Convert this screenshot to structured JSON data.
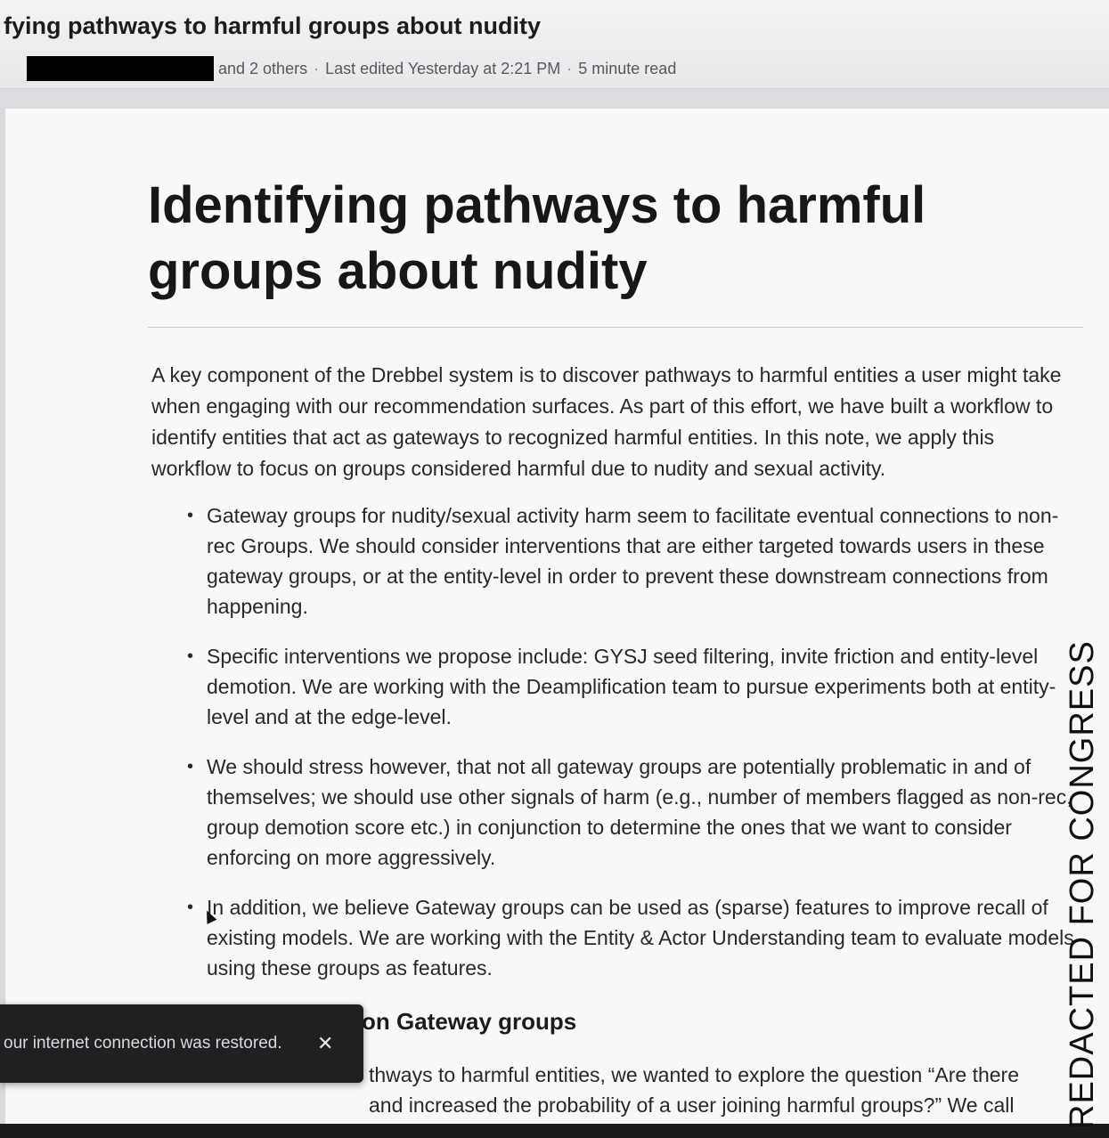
{
  "header": {
    "title": "fying pathways to harmful groups about nudity",
    "authors_suffix": "and 2 others",
    "last_edited": "Last edited Yesterday at 2:21 PM",
    "read_time": "5 minute read",
    "separator": "·"
  },
  "document": {
    "title": "Identifying pathways to harmful groups about nudity",
    "intro": "A key component of the Drebbel system is to discover pathways to harmful entities a user might take when engaging with our recommendation surfaces. As part of this effort, we have built a workflow to identify entities that act as gateways to recognized harmful entities. In this note, we apply this workflow to focus on groups considered harmful due to nudity and sexual activity.",
    "bullets": [
      "Gateway groups for nudity/sexual activity harm seem to facilitate eventual connections to non-rec Groups. We should consider interventions that are either targeted towards users in these gateway groups, or at the entity-level in order to prevent these downstream connections from happening.",
      "Specific interventions we propose include: GYSJ seed filtering, invite friction and entity-level demotion. We are working with the Deamplification team to pursue experiments both at entity-level and at the edge-level.",
      "We should stress however, that not all gateway groups are potentially problematic in and of themselves; we should use other signals of harm (e.g., number of members flagged as non-rec, group demotion score etc.) in conjunction to determine the ones that we want to consider enforcing on more aggressively.",
      "In addition, we believe Gateway groups can be used as (sparse) features to improve recall of existing models. We are working with the Entity & Actor Understanding team to evaluate models using these groups as features."
    ],
    "section_heading_visible": "on Gateway groups",
    "para2_line1_visible": "thways to harmful entities, we wanted to explore the question “Are there",
    "para2_line2_visible": "and increased the probability of a user joining harmful groups?” We call"
  },
  "toast": {
    "message": "our internet connection was restored.",
    "close_glyph": "✕"
  },
  "watermark": "REDACTED FOR CONGRESS",
  "bullet_glyph": "•"
}
